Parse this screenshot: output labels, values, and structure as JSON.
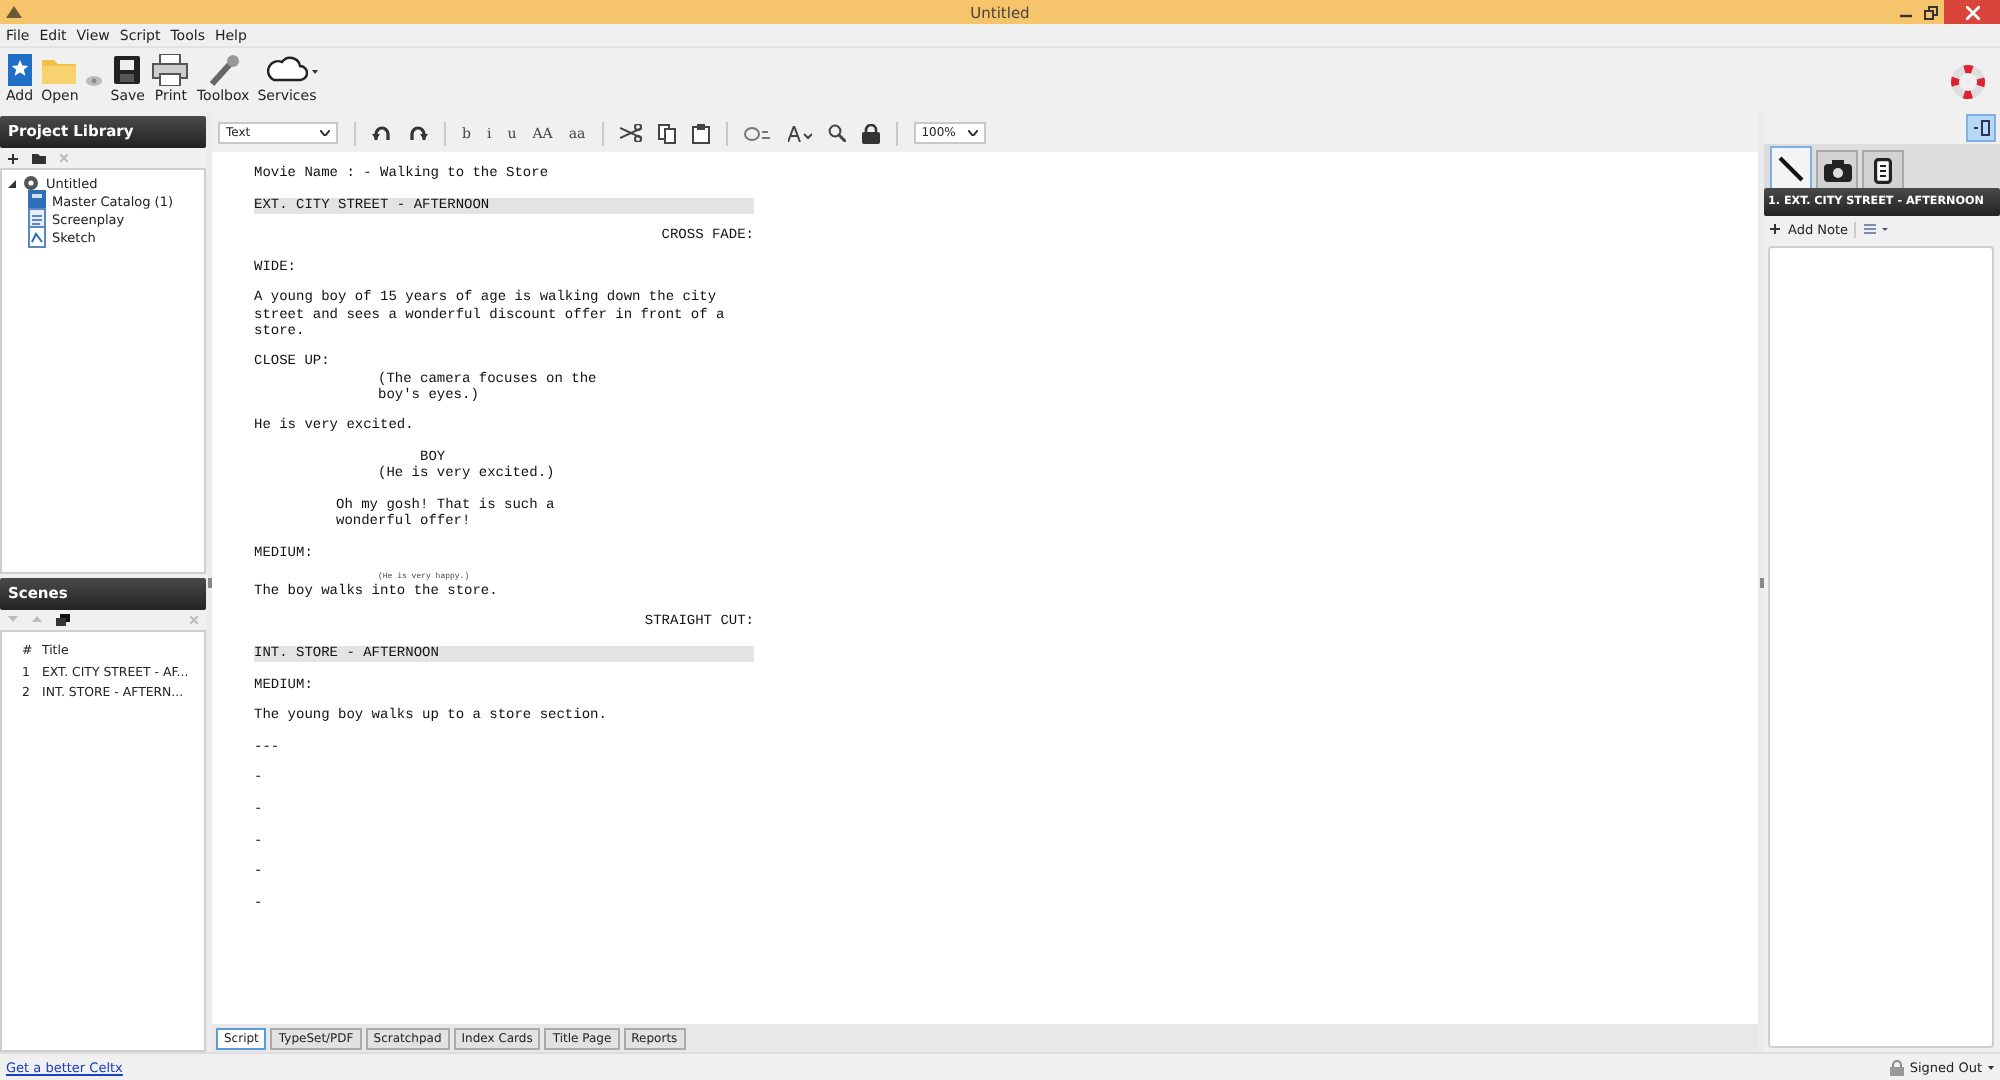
{
  "window": {
    "title": "Untitled"
  },
  "menu": [
    "File",
    "Edit",
    "View",
    "Script",
    "Tools",
    "Help"
  ],
  "toolbar": [
    {
      "kind": "add",
      "label": "Add"
    },
    {
      "kind": "open",
      "label": "Open"
    },
    {
      "kind": "eye"
    },
    {
      "kind": "save",
      "label": "Save"
    },
    {
      "kind": "print",
      "label": "Print"
    },
    {
      "kind": "toolbox",
      "label": "Toolbox"
    },
    {
      "kind": "services",
      "label": "Services",
      "has_menu": true
    }
  ],
  "project_library": {
    "title": "Project Library",
    "tree": [
      {
        "label": "Untitled",
        "kind": "project",
        "expanded": true,
        "children": [
          {
            "label": "Master Catalog (1)",
            "kind": "catalog"
          },
          {
            "label": "Screenplay",
            "kind": "screenplay"
          },
          {
            "label": "Sketch",
            "kind": "sketch"
          }
        ]
      }
    ]
  },
  "scenes": {
    "title": "Scenes",
    "columns": [
      "#",
      "Title"
    ],
    "rows": [
      {
        "number": "1",
        "title": "EXT. CITY STREET - AF..."
      },
      {
        "number": "2",
        "title": "INT. STORE - AFTERN..."
      }
    ]
  },
  "format_toolbar": {
    "style": "Text",
    "zoom": "100%",
    "groups": [
      [
        {
          "kind": "undo"
        },
        {
          "kind": "redo"
        }
      ],
      [
        {
          "kind": "text",
          "label": "b"
        },
        {
          "kind": "text",
          "label": "i"
        },
        {
          "kind": "text",
          "label": "u"
        },
        {
          "kind": "text",
          "label": "AA"
        },
        {
          "kind": "text",
          "label": "aa"
        }
      ],
      [
        {
          "kind": "cut"
        },
        {
          "kind": "copy"
        },
        {
          "kind": "paste"
        }
      ],
      [
        {
          "kind": "find"
        },
        {
          "kind": "font"
        },
        {
          "kind": "search"
        },
        {
          "kind": "lock"
        }
      ]
    ]
  },
  "script": {
    "lines": [
      {
        "kind": "title",
        "text": "Movie Name : - Walking to the Store"
      },
      {
        "kind": "heading",
        "text": "EXT. CITY STREET - AFTERNOON"
      },
      {
        "kind": "transition",
        "text": "CROSS FADE:"
      },
      {
        "kind": "shot",
        "text": "WIDE:"
      },
      {
        "kind": "action",
        "text": "A young boy of 15 years of age is walking down the city street and sees a wonderful discount offer in front of a store."
      },
      {
        "kind": "shot",
        "text": "CLOSE UP:"
      },
      {
        "kind": "parenthetical",
        "text": "(The camera focuses on the boy's eyes.)",
        "joined": true
      },
      {
        "kind": "action",
        "text": "He is very excited."
      },
      {
        "kind": "character",
        "text": "BOY"
      },
      {
        "kind": "parenthetical",
        "text": "(He is very excited.)",
        "joined": true
      },
      {
        "kind": "dialogue",
        "text": "Oh my gosh! That is such a wonderful offer!"
      },
      {
        "kind": "shot",
        "text": "MEDIUM:"
      },
      {
        "kind": "squeezed",
        "text": "(He is very happy.)"
      },
      {
        "kind": "action",
        "text": "The boy walks into the store."
      },
      {
        "kind": "transition",
        "text": "STRAIGHT CUT:"
      },
      {
        "kind": "heading",
        "text": "INT. STORE - AFTERNOON"
      },
      {
        "kind": "shot",
        "text": "MEDIUM:"
      },
      {
        "kind": "action",
        "text": "The young boy walks up to a store section."
      },
      {
        "kind": "action",
        "text": "---"
      },
      {
        "kind": "action",
        "text": "-"
      },
      {
        "kind": "action",
        "text": "-"
      },
      {
        "kind": "action",
        "text": "-"
      },
      {
        "kind": "action",
        "text": "-"
      },
      {
        "kind": "action",
        "text": "-"
      }
    ]
  },
  "notes_panel": {
    "tabs": [
      {
        "kind": "pen",
        "selected": true
      },
      {
        "kind": "camera",
        "selected": false
      },
      {
        "kind": "card",
        "selected": false
      }
    ],
    "scene_title": "1. EXT. CITY STREET - AFTERNOON",
    "add_note": "Add Note"
  },
  "view_tabs": [
    {
      "label": "Script",
      "selected": true
    },
    {
      "label": "TypeSet/PDF",
      "selected": false
    },
    {
      "label": "Scratchpad",
      "selected": false
    },
    {
      "label": "Index Cards",
      "selected": false
    },
    {
      "label": "Title Page",
      "selected": false
    },
    {
      "label": "Reports",
      "selected": false
    }
  ],
  "status_bar": {
    "link": "Get a better Celtx",
    "user": "Signed Out"
  }
}
